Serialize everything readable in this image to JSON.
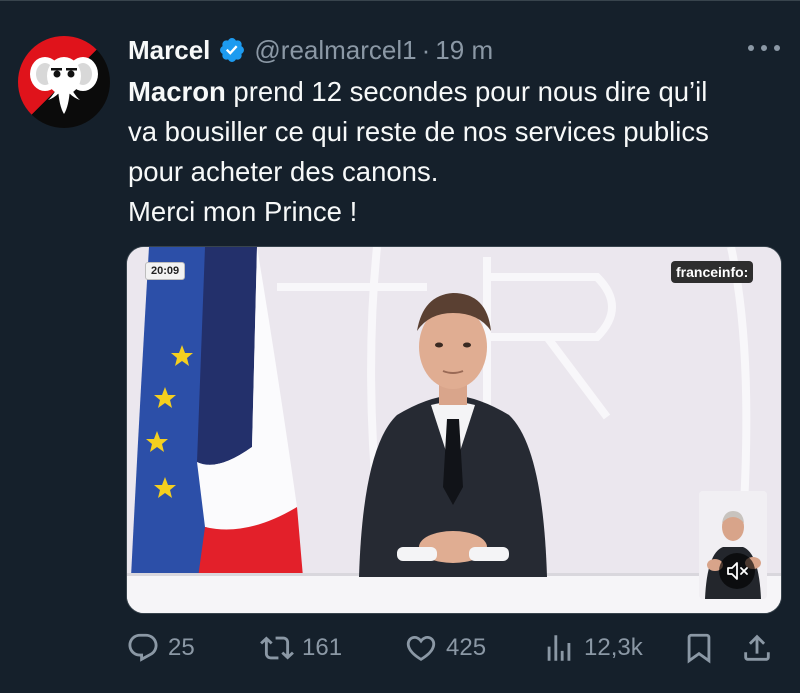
{
  "tweet": {
    "author_name": "Marcel",
    "handle": "@realmarcel1",
    "separator": "·",
    "time": "19 m",
    "text_bold": "Macron",
    "text_lines": [
      " prend 12 secondes pour nous dire qu’il",
      "va bousiller ce qui reste de nos services publics",
      "pour acheter des canons.",
      "Merci mon Prince !"
    ],
    "verified": true
  },
  "media": {
    "timestamp": "20:09",
    "channel": "franceinfo:",
    "muted": true
  },
  "actions": {
    "replies": "25",
    "retweets": "161",
    "likes": "425",
    "views": "12,3k"
  },
  "colors": {
    "background": "#15202b",
    "text_primary": "#f7f9f9",
    "text_secondary": "#8b98a5",
    "verified_blue": "#1d9bf0",
    "divider": "#38444d"
  },
  "icons": {
    "reply": "reply-icon",
    "retweet": "retweet-icon",
    "like": "heart-icon",
    "views": "views-icon",
    "bookmark": "bookmark-icon",
    "share": "share-icon",
    "more": "more-icon",
    "verified": "verified-badge-icon"
  }
}
